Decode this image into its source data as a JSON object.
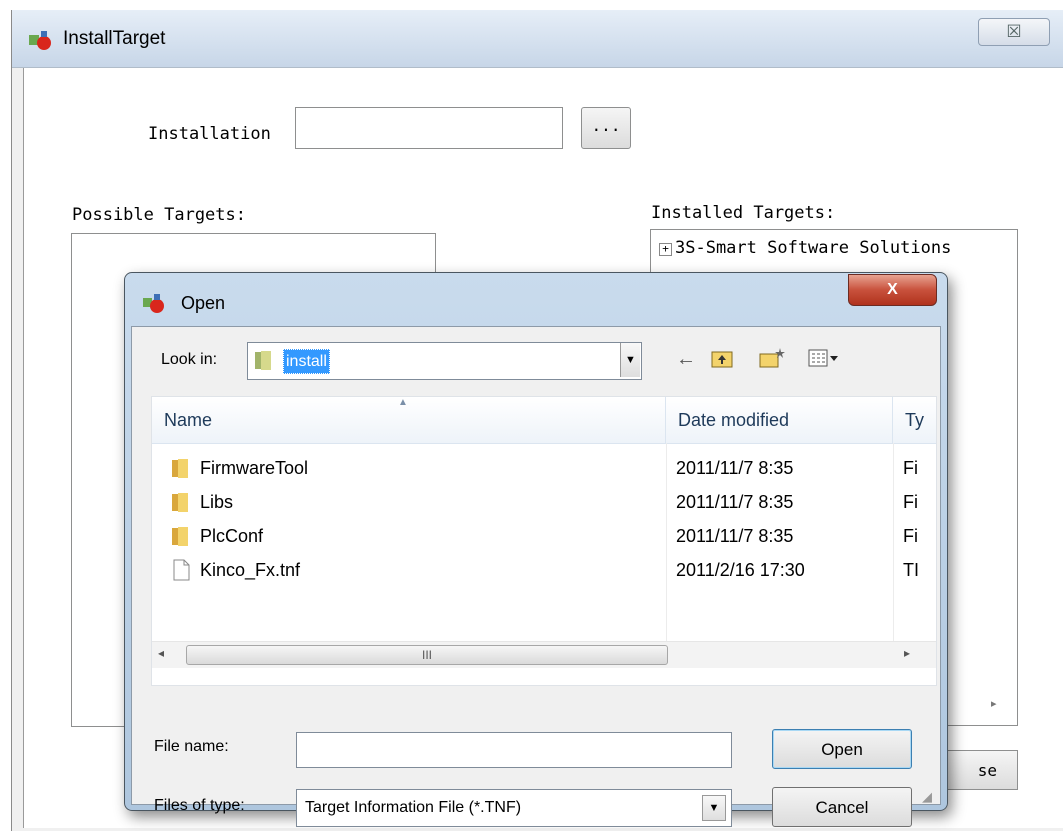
{
  "outer": {
    "title": "InstallTarget",
    "close_glyph": "☒",
    "installation_label": "Installation",
    "browse_label": "...",
    "possible_targets_label": "Possible Targets:",
    "installed_targets_label": "Installed Targets:",
    "installed_tree": [
      "3S-Smart Software Solutions"
    ],
    "close_button_label": "se"
  },
  "dialog": {
    "title": "Open",
    "close_glyph": "X",
    "look_in_label": "Look in:",
    "look_in_value": "install",
    "toolbar_icons": [
      "back-icon",
      "up-folder-icon",
      "new-folder-icon",
      "view-menu-icon"
    ],
    "columns": [
      "Name",
      "Date modified",
      "Ty"
    ],
    "files": [
      {
        "name": "FirmwareTool",
        "date": "2011/11/7 8:35",
        "type": "Fi",
        "kind": "folder"
      },
      {
        "name": "Libs",
        "date": "2011/11/7 8:35",
        "type": "Fi",
        "kind": "folder"
      },
      {
        "name": "PlcConf",
        "date": "2011/11/7 8:35",
        "type": "Fi",
        "kind": "folder"
      },
      {
        "name": "Kinco_Fx.tnf",
        "date": "2011/2/16 17:30",
        "type": "TI",
        "kind": "file"
      }
    ],
    "hscroll_thumb": "III",
    "file_name_label": "File name:",
    "file_name_value": "",
    "files_of_type_label": "Files of type:",
    "files_of_type_value": "Target Information File (*.TNF)",
    "open_button": "Open",
    "cancel_button": "Cancel"
  }
}
